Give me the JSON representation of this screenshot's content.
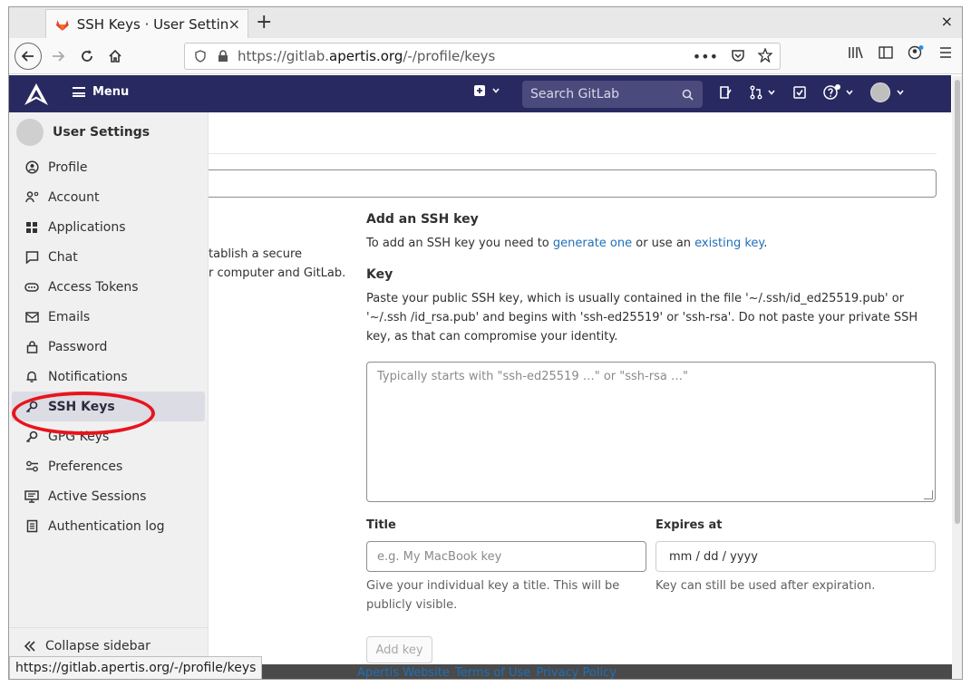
{
  "browser": {
    "tab_title": "SSH Keys · User Settings",
    "tab_close": "×",
    "new_tab": "+",
    "window_close": "×",
    "url_prefix": "https://gitlab.",
    "url_domain": "apertis.org",
    "url_path": "/-/profile/keys",
    "url_more": "•••",
    "status_url": "https://gitlab.apertis.org/-/profile/keys"
  },
  "header": {
    "menu_label": "Menu",
    "search_placeholder": "Search GitLab"
  },
  "sidebar": {
    "title": "User Settings",
    "items": [
      {
        "label": "Profile",
        "icon": "profile-icon"
      },
      {
        "label": "Account",
        "icon": "account-icon"
      },
      {
        "label": "Applications",
        "icon": "applications-icon"
      },
      {
        "label": "Chat",
        "icon": "chat-icon"
      },
      {
        "label": "Access Tokens",
        "icon": "token-icon"
      },
      {
        "label": "Emails",
        "icon": "mail-icon"
      },
      {
        "label": "Password",
        "icon": "lock-icon"
      },
      {
        "label": "Notifications",
        "icon": "bell-icon"
      },
      {
        "label": "SSH Keys",
        "icon": "key-icon"
      },
      {
        "label": "GPG Keys",
        "icon": "key-icon"
      },
      {
        "label": "Preferences",
        "icon": "preferences-icon"
      },
      {
        "label": "Active Sessions",
        "icon": "monitor-icon"
      },
      {
        "label": "Authentication log",
        "icon": "log-icon"
      }
    ],
    "active_index": 8,
    "collapse_label": "Collapse sidebar"
  },
  "main": {
    "left_desc_line1": "tablish a secure",
    "left_desc_line2": "r computer and GitLab.",
    "add_heading": "Add an SSH key",
    "add_text_before": "To add an SSH key you need to ",
    "add_link1": "generate one",
    "add_text_mid": " or use an ",
    "add_link2": "existing key",
    "add_text_end": ".",
    "key_heading": "Key",
    "key_desc": "Paste your public SSH key, which is usually contained in the file '~/.ssh/id_ed25519.pub' or '~/.ssh /id_rsa.pub' and begins with 'ssh-ed25519' or 'ssh-rsa'. Do not paste your private SSH key, as that can compromise your identity.",
    "key_placeholder": "Typically starts with \"ssh-ed25519 …\" or \"ssh-rsa …\"",
    "title_label": "Title",
    "title_placeholder": "e.g. My MacBook key",
    "title_help": "Give your individual key a title. This will be publicly visible.",
    "expires_label": "Expires at",
    "expires_value": "mm / dd / yyyy",
    "expires_help": "Key can still be used after expiration.",
    "add_button": "Add key"
  },
  "footer": {
    "links": [
      "Apertis Website",
      "Terms of Use",
      "Privacy Policy"
    ]
  },
  "colors": {
    "header_bg": "#292961",
    "link": "#1f6fb8",
    "highlight_ring": "#e8141c"
  }
}
